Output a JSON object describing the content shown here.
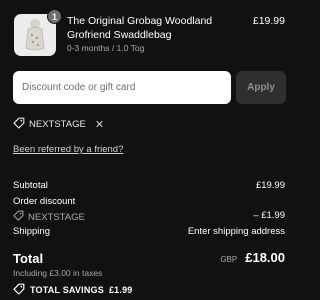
{
  "product": {
    "quantity": "1",
    "title": "The Original Grobag Woodland Grofriend Swaddlebag",
    "variant": "0-3 months / 1.0 Tog",
    "price": "£19.99",
    "image_icon": "swaddlebag-image"
  },
  "discount": {
    "placeholder": "Discount code or gift card",
    "value": "",
    "apply_label": "Apply",
    "applied_code": "NEXTSTAGE",
    "tag_icon": "tag-icon",
    "remove_icon": "close-icon"
  },
  "referral_link": "Been referred by a friend?",
  "summary": {
    "subtotal_label": "Subtotal",
    "subtotal_value": "£19.99",
    "order_discount_label": "Order discount",
    "discount_code": "NEXTSTAGE",
    "discount_value": "– £1.99",
    "shipping_label": "Shipping",
    "shipping_value": "Enter shipping address",
    "total_label": "Total",
    "currency": "GBP",
    "total_value": "£18.00",
    "taxes_note": "Including £3.00 in taxes",
    "savings_label": "TOTAL SAVINGS",
    "savings_value": "£1.99"
  },
  "colors": {
    "background": "#111111",
    "input_bg": "#ffffff",
    "button_bg": "#2f2f2f",
    "muted_text": "#a8a8a8"
  }
}
